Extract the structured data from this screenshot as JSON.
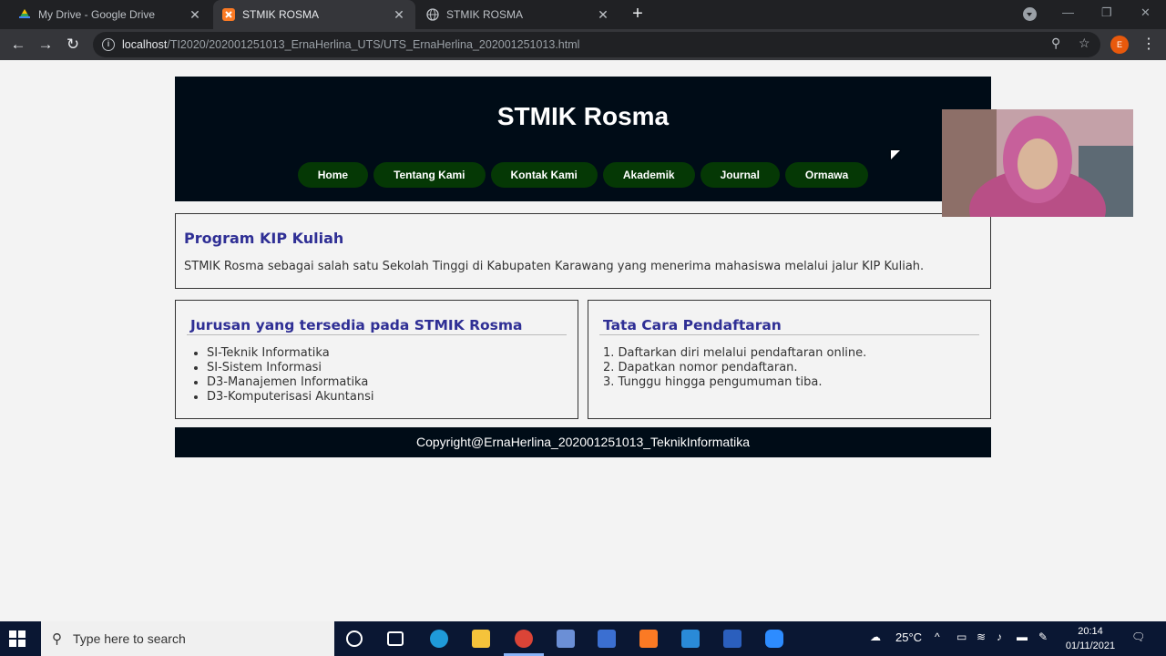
{
  "browser": {
    "tabs": [
      {
        "title": "My Drive - Google Drive",
        "active": false
      },
      {
        "title": "STMIK ROSMA",
        "active": true
      },
      {
        "title": "STMIK ROSMA",
        "active": false
      }
    ],
    "new_tab": "+",
    "url_host": "localhost",
    "url_path": "/TI2020/202001251013_ErnaHerlina_UTS/UTS_ErnaHerlina_202001251013.html",
    "profile_initial": "E"
  },
  "site": {
    "title": "STMIK Rosma",
    "nav": [
      "Home",
      "Tentang Kami",
      "Kontak Kami",
      "Akademik",
      "Journal",
      "Ormawa"
    ],
    "kip": {
      "heading": "Program KIP Kuliah",
      "text": "STMIK Rosma sebagai salah satu Sekolah Tinggi di Kabupaten Karawang yang menerima mahasiswa melalui jalur KIP Kuliah."
    },
    "jurusan": {
      "heading": "Jurusan yang tersedia pada STMIK Rosma",
      "items": [
        "SI-Teknik Informatika",
        "SI-Sistem Informasi",
        "D3-Manajemen Informatika",
        "D3-Komputerisasi Akuntansi"
      ]
    },
    "pendaftaran": {
      "heading": "Tata Cara Pendaftaran",
      "steps": [
        "1. Daftarkan diri melalui pendaftaran online.",
        "2. Dapatkan nomor pendaftaran.",
        "3. Tunggu hingga pengumuman tiba."
      ]
    },
    "footer": "Copyright@ErnaHerlina_202001251013_TeknikInformatika"
  },
  "taskbar": {
    "search_placeholder": "Type here to search",
    "weather": "25°C",
    "time": "20:14",
    "date": "01/11/2021"
  }
}
